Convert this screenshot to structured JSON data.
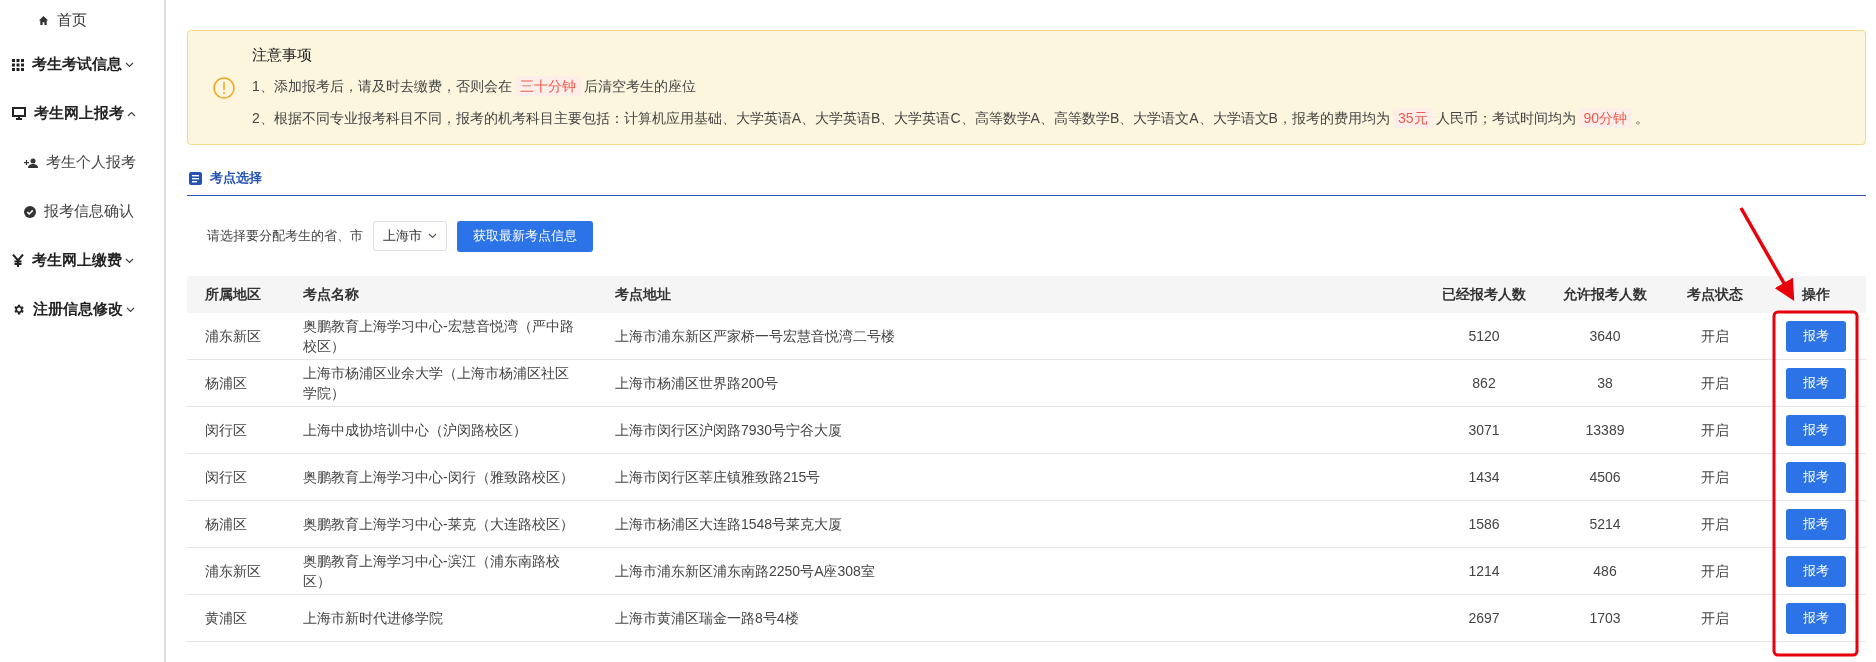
{
  "sidebar": {
    "items": [
      {
        "kind": "link",
        "label": "首页"
      },
      {
        "kind": "group",
        "label": "考生考试信息",
        "expanded": false
      },
      {
        "kind": "group",
        "label": "考生网上报考",
        "expanded": true,
        "children": [
          {
            "kind": "sub",
            "label": "考生个人报考"
          },
          {
            "kind": "sub",
            "label": "报考信息确认"
          }
        ]
      },
      {
        "kind": "group",
        "label": "考生网上缴费",
        "expanded": false
      },
      {
        "kind": "group",
        "label": "注册信息修改",
        "expanded": false
      }
    ]
  },
  "notice": {
    "title": "注意事项",
    "lines": [
      [
        {
          "kind": "text",
          "text": "1、添加报考后，请及时去缴费，否则会在"
        },
        {
          "kind": "highlight",
          "text": "三十分钟"
        },
        {
          "kind": "text",
          "text": "后清空考生的座位"
        }
      ],
      [
        {
          "kind": "text",
          "text": "2、根据不同专业报考科目不同，报考的机考科目主要包括：计算机应用基础、大学英语A、大学英语B、大学英语C、高等数学A、高等数学B、大学语文A、大学语文B，报考的费用均为"
        },
        {
          "kind": "highlight",
          "text": "35元"
        },
        {
          "kind": "text",
          "text": "人民币；考试时间均为"
        },
        {
          "kind": "highlight",
          "text": "90分钟"
        },
        {
          "kind": "text",
          "text": "。"
        }
      ]
    ]
  },
  "section": {
    "title": "考点选择"
  },
  "filter": {
    "label": "请选择要分配考生的省、市",
    "select_value": "上海市",
    "button": "获取最新考点信息"
  },
  "table": {
    "columns": [
      "所属地区",
      "考点名称",
      "考点地址",
      "已经报考人数",
      "允许报考人数",
      "考点状态",
      "操作"
    ],
    "rows": [
      {
        "district": "浦东新区",
        "name": "奥鹏教育上海学习中心-宏慧音悦湾（严中路校区）",
        "address": "上海市浦东新区严家桥一号宏慧音悦湾二号楼",
        "registered": "5120",
        "allowed": "3640",
        "status": "开启",
        "action": "报考"
      },
      {
        "district": "杨浦区",
        "name": "上海市杨浦区业余大学（上海市杨浦区社区学院）",
        "address": "上海市杨浦区世界路200号",
        "registered": "862",
        "allowed": "38",
        "status": "开启",
        "action": "报考"
      },
      {
        "district": "闵行区",
        "name": "上海中成协培训中心（沪闵路校区）",
        "address": "上海市闵行区沪闵路7930号宁谷大厦",
        "registered": "3071",
        "allowed": "13389",
        "status": "开启",
        "action": "报考"
      },
      {
        "district": "闵行区",
        "name": "奥鹏教育上海学习中心-闵行（雅致路校区）",
        "address": "上海市闵行区莘庄镇雅致路215号",
        "registered": "1434",
        "allowed": "4506",
        "status": "开启",
        "action": "报考"
      },
      {
        "district": "杨浦区",
        "name": "奥鹏教育上海学习中心-莱克（大连路校区）",
        "address": "上海市杨浦区大连路1548号莱克大厦",
        "registered": "1586",
        "allowed": "5214",
        "status": "开启",
        "action": "报考"
      },
      {
        "district": "浦东新区",
        "name": "奥鹏教育上海学习中心-滨江（浦东南路校区）",
        "address": "上海市浦东新区浦东南路2250号A座308室",
        "registered": "1214",
        "allowed": "486",
        "status": "开启",
        "action": "报考"
      },
      {
        "district": "黄浦区",
        "name": "上海市新时代进修学院",
        "address": "上海市黄浦区瑞金一路8号4楼",
        "registered": "2697",
        "allowed": "1703",
        "status": "开启",
        "action": "报考"
      }
    ]
  },
  "annotation": {
    "kind": "arrow-and-frame"
  }
}
